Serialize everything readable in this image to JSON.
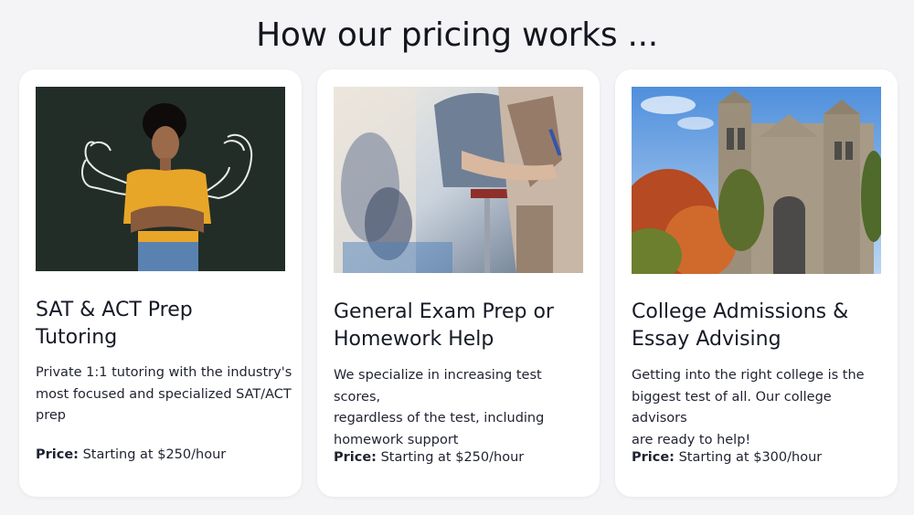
{
  "page": {
    "heading": "How our pricing works ..."
  },
  "cards": [
    {
      "title_line1": "SAT & ACT Prep",
      "title_line2": "Tutoring",
      "desc_line1": "Private 1:1 tutoring with the industry's",
      "desc_line2": "most focused and specialized SAT/ACT",
      "desc_line3": "prep",
      "price_label": "Price:",
      "price_value": " Starting at $250/hour",
      "image": "student-flexing-chalkboard-photo"
    },
    {
      "title_line1": "General Exam Prep or",
      "title_line2": "Homework Help",
      "desc_line1": "We specialize in increasing test scores,",
      "desc_line2": "regardless of the test, including",
      "desc_line3": "homework support",
      "price_label": "Price:",
      "price_value": " Starting at $250/hour",
      "image": "students-taking-exam-photo"
    },
    {
      "title_line1": "College Admissions &",
      "title_line2": "Essay Advising",
      "desc_line1": "Getting into the right college is the",
      "desc_line2": "biggest test of all. Our college advisors",
      "desc_line3": "are ready to help!",
      "price_label": "Price:",
      "price_value": " Starting at $300/hour",
      "image": "college-campus-building-photo"
    }
  ],
  "colors": {
    "background": "#f4f4f6",
    "card": "#ffffff",
    "text": "#1c1f2a"
  }
}
